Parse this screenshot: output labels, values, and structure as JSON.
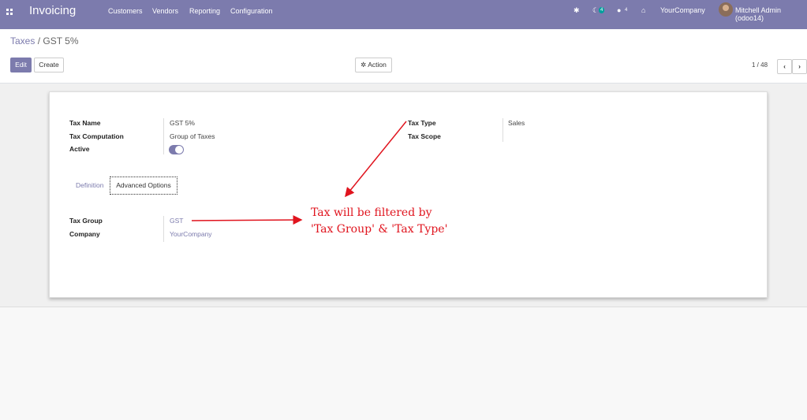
{
  "navbar": {
    "app_name": "Invoicing",
    "menu": [
      "Customers",
      "Vendors",
      "Reporting",
      "Configuration"
    ],
    "activity_count": "4",
    "message_count": "4",
    "company": "YourCompany",
    "user": "Mitchell Admin (odoo14)"
  },
  "breadcrumb": {
    "parent": "Taxes",
    "separator": " / ",
    "current": "GST 5%"
  },
  "buttons": {
    "edit": "Edit",
    "create": "Create",
    "action": "Action"
  },
  "pager": {
    "value": "1 / 48"
  },
  "form": {
    "tax_name": {
      "label": "Tax Name",
      "value": "GST 5%"
    },
    "tax_computation": {
      "label": "Tax Computation",
      "value": "Group of Taxes"
    },
    "active": {
      "label": "Active",
      "value": true
    },
    "tax_type": {
      "label": "Tax Type",
      "value": "Sales"
    },
    "tax_scope": {
      "label": "Tax Scope",
      "value": ""
    },
    "tabs": [
      "Definition",
      "Advanced Options"
    ],
    "tax_group": {
      "label": "Tax Group",
      "value": "GST"
    },
    "company": {
      "label": "Company",
      "value": "YourCompany"
    }
  },
  "annotation": {
    "line1": "Tax will be filtered by",
    "line2": "'Tax Group' & 'Tax Type'",
    "color": "#e0141e"
  },
  "colors": {
    "brand": "#7c7bad"
  }
}
